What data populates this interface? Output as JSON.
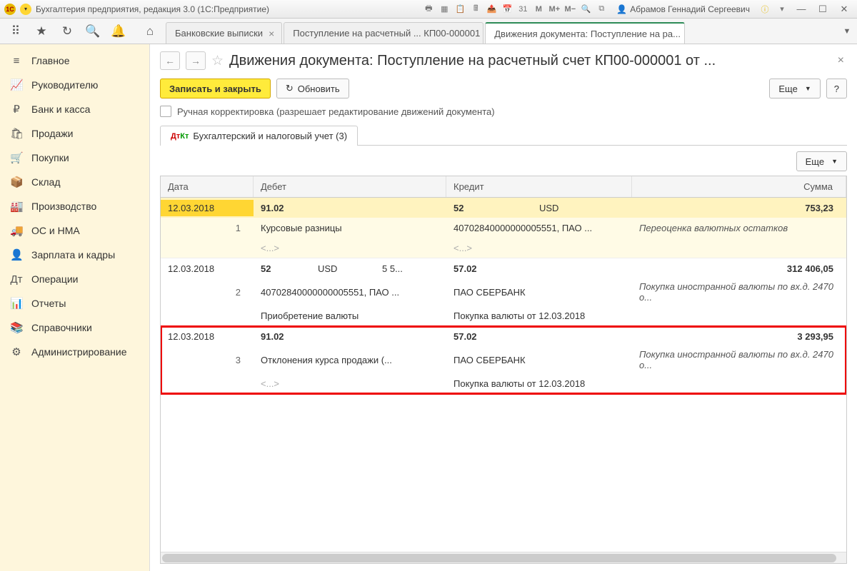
{
  "titlebar": {
    "app_title": "Бухгалтерия предприятия, редакция 3.0  (1С:Предприятие)",
    "user": "Абрамов Геннадий Сергеевич"
  },
  "toptabs": [
    {
      "label": "Банковские выписки"
    },
    {
      "label": "Поступление на расчетный ... КП00-000001"
    },
    {
      "label": "Движения документа: Поступление на ра..."
    }
  ],
  "sidebar": [
    {
      "icon": "≡",
      "label": "Главное"
    },
    {
      "icon": "📈",
      "label": "Руководителю"
    },
    {
      "icon": "₽",
      "label": "Банк и касса"
    },
    {
      "icon": "🛍",
      "label": "Продажи"
    },
    {
      "icon": "🛒",
      "label": "Покупки"
    },
    {
      "icon": "📦",
      "label": "Склад"
    },
    {
      "icon": "🏭",
      "label": "Производство"
    },
    {
      "icon": "🚚",
      "label": "ОС и НМА"
    },
    {
      "icon": "👤",
      "label": "Зарплата и кадры"
    },
    {
      "icon": "Дт",
      "label": "Операции"
    },
    {
      "icon": "📊",
      "label": "Отчеты"
    },
    {
      "icon": "📚",
      "label": "Справочники"
    },
    {
      "icon": "⚙",
      "label": "Администрирование"
    }
  ],
  "page": {
    "title": "Движения документа: Поступление на расчетный счет КП00-000001 от ...",
    "save_close": "Записать и закрыть",
    "refresh": "Обновить",
    "more": "Еще",
    "help": "?",
    "manual_edit": "Ручная корректировка (разрешает редактирование движений документа)",
    "tab_label": "Бухгалтерский и налоговый учет (3)"
  },
  "table": {
    "headers": {
      "date": "Дата",
      "debit": "Дебет",
      "credit": "Кредит",
      "sum": "Сумма"
    },
    "rows": [
      {
        "highlighted": false,
        "yellow": true,
        "date": "12.03.2018",
        "num": "1",
        "debit_acc": "91.02",
        "debit_cur": "",
        "debit_val": "",
        "debit_line2": "Курсовые разницы",
        "debit_line3": "<...>",
        "credit_acc": "52",
        "credit_cur": "USD",
        "credit_line2": "40702840000000005551, ПАО ...",
        "credit_line3": "<...>",
        "sum": "753,23",
        "sum_desc": "Переоценка валютных остатков"
      },
      {
        "highlighted": false,
        "yellow": false,
        "date": "12.03.2018",
        "num": "2",
        "debit_acc": "52",
        "debit_cur": "USD",
        "debit_val": "5 5...",
        "debit_line2": "40702840000000005551, ПАО ...",
        "debit_line3": "Приобретение валюты",
        "credit_acc": "57.02",
        "credit_cur": "",
        "credit_line2": "ПАО СБЕРБАНК",
        "credit_line3": "Покупка валюты от 12.03.2018",
        "sum": "312 406,05",
        "sum_desc": "Покупка иностранной валюты по вх.д. 2470 о..."
      },
      {
        "highlighted": true,
        "yellow": false,
        "date": "12.03.2018",
        "num": "3",
        "debit_acc": "91.02",
        "debit_cur": "",
        "debit_val": "",
        "debit_line2": "Отклонения курса продажи (...",
        "debit_line3": "<...>",
        "credit_acc": "57.02",
        "credit_cur": "",
        "credit_line2": "ПАО СБЕРБАНК",
        "credit_line3": "Покупка валюты от 12.03.2018",
        "sum": "3 293,95",
        "sum_desc": "Покупка иностранной валюты по вх.д. 2470 о..."
      }
    ]
  }
}
